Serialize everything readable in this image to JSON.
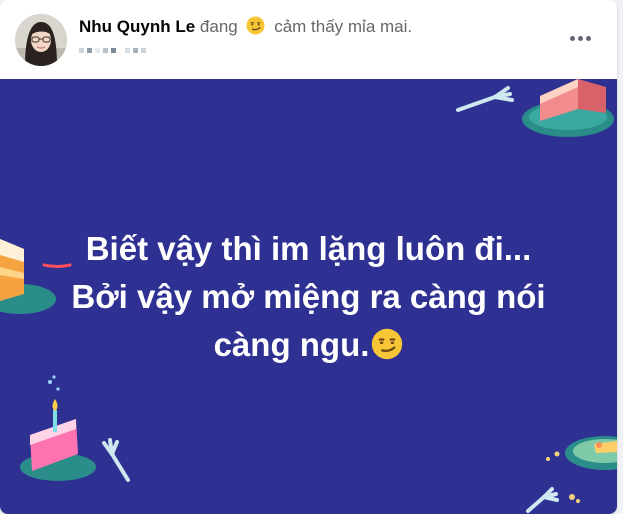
{
  "post": {
    "author_name": "Nhu Quynh Le",
    "status_prefix": "đang",
    "feeling_text": "cảm thấy mỉa mai.",
    "feeling_icon": "smirking-face-icon"
  },
  "message": {
    "line1": "Biết vậy thì im lặng luôn đi...",
    "line2": "Bởi vậy mở miệng ra càng nói",
    "line3": "càng ngu.",
    "end_icon": "smirking-face-icon"
  },
  "colors": {
    "banner_background": "#2e3192",
    "text": "#ffffff",
    "author": "#050505",
    "secondary": "#65676b"
  }
}
